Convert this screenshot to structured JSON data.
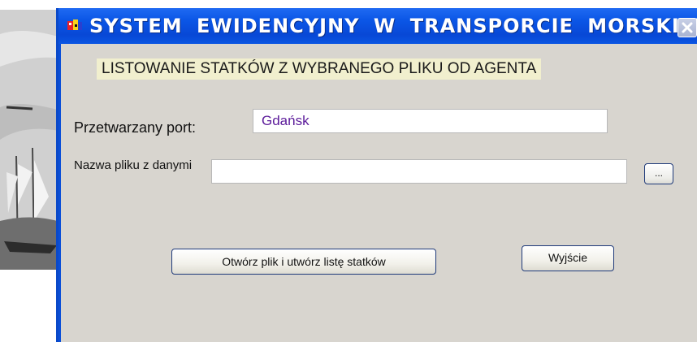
{
  "window": {
    "title": "SYSTEM EWIDENCYJNY W TRANSPORCIE MORSKIM",
    "title_bar_color": "#0a4fd8",
    "client_color": "#d8d5cf"
  },
  "form": {
    "heading": "LISTOWANIE STATKÓW Z WYBRANEGO PLIKU OD AGENTA",
    "port_label": "Przetwarzany port:",
    "port_value": "Gdańsk",
    "file_label": "Nazwa pliku z danymi",
    "file_value": "",
    "browse_label": "...",
    "open_button_label": "Otwórz plik i  utwórz listę statków",
    "exit_button_label": "Wyjście"
  },
  "icons": {
    "app": "app-icon",
    "close": "close-icon",
    "background_photo": "sailing-ship-photo"
  }
}
